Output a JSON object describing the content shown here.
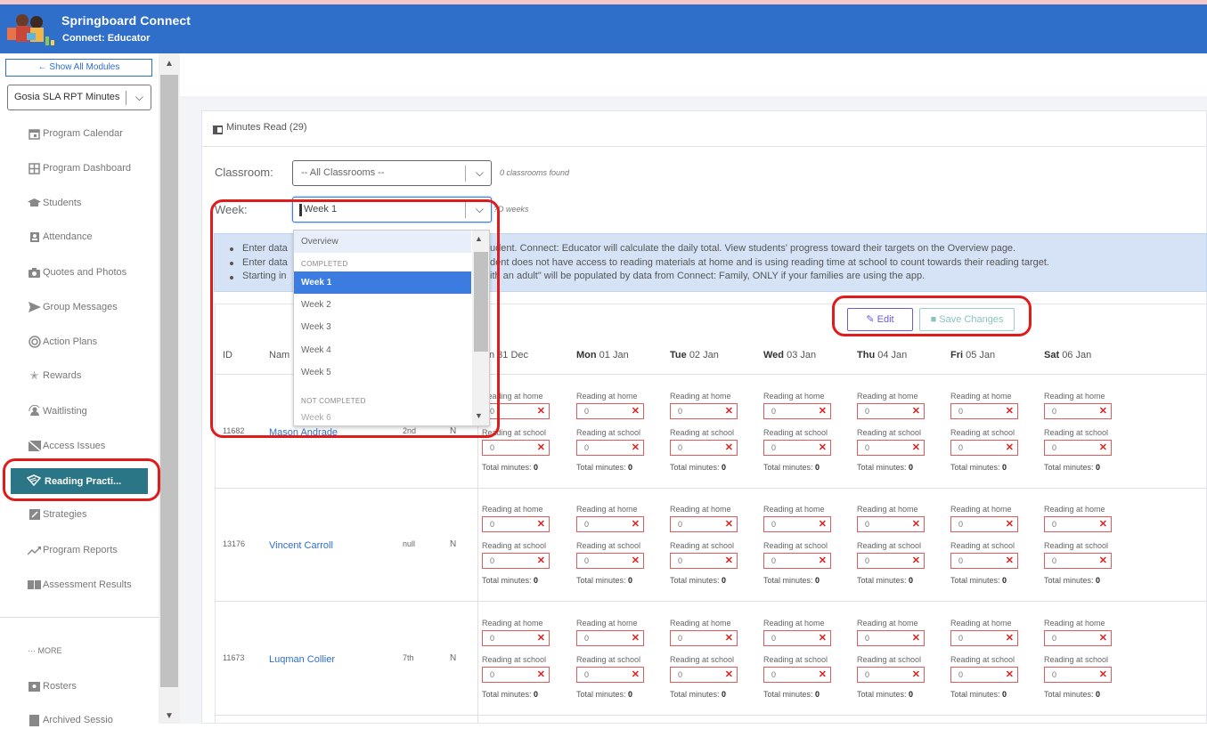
{
  "app": {
    "title": "Springboard Connect",
    "subtitle": "Connect: Educator"
  },
  "sidebar": {
    "show_all": "Show All Modules",
    "module": "Gosia SLA RPT Minutes",
    "items": [
      {
        "label": "Program Calendar",
        "icon": "calendar-icon"
      },
      {
        "label": "Program Dashboard",
        "icon": "dashboard-icon"
      },
      {
        "label": "Students",
        "icon": "graduation-cap-icon"
      },
      {
        "label": "Attendance",
        "icon": "id-badge-icon"
      },
      {
        "label": "Quotes and Photos",
        "icon": "camera-icon"
      },
      {
        "label": "Group Messages",
        "icon": "send-icon"
      },
      {
        "label": "Action Plans",
        "icon": "target-icon"
      },
      {
        "label": "Rewards",
        "icon": "trophy-icon"
      },
      {
        "label": "Waitlisting",
        "icon": "user-refresh-icon"
      },
      {
        "label": "Access Issues",
        "icon": "blocked-image-icon"
      },
      {
        "label": "Reading Practi...",
        "icon": "reading-icon"
      },
      {
        "label": "Strategies",
        "icon": "edit-square-icon"
      },
      {
        "label": "Program Reports",
        "icon": "trend-icon"
      },
      {
        "label": "Assessment Results",
        "icon": "book-icon"
      }
    ],
    "more": "··· MORE",
    "bottom_items": [
      {
        "label": "Rosters",
        "icon": "id-card-icon"
      },
      {
        "label": "Archived Sessio",
        "icon": "archive-icon"
      }
    ]
  },
  "panel": {
    "title": "Minutes Read (29)"
  },
  "filters": {
    "classroom_label": "Classroom:",
    "classroom_value": "-- All Classrooms --",
    "classroom_note": "0 classrooms found",
    "week_label": "Week:",
    "week_value": "Week 1",
    "week_note": "?D weeks"
  },
  "info": [
    {
      "start": "Enter data",
      "end": "udent. Connect: Educator will calculate the daily total. View students' progress toward their targets on the Overview page."
    },
    {
      "start": "Enter data",
      "end": "dent does not have access to reading materials at home and is using reading time at school to count towards their reading target."
    },
    {
      "start": "Starting in",
      "end": "ith an adult\" will be populated by data from Connect: Family, ONLY if your families are using the app."
    }
  ],
  "buttons": {
    "edit": "Edit",
    "save": "Save Changes"
  },
  "table": {
    "headers": {
      "id": "ID",
      "name": "Nam"
    },
    "days": [
      {
        "dow": "",
        "date": "n 31 Dec"
      },
      {
        "dow": "Mon",
        "date": "01 Jan"
      },
      {
        "dow": "Tue",
        "date": "02 Jan"
      },
      {
        "dow": "Wed",
        "date": "03 Jan"
      },
      {
        "dow": "Thu",
        "date": "04 Jan"
      },
      {
        "dow": "Fri",
        "date": "05 Jan"
      },
      {
        "dow": "Sat",
        "date": "06 Jan"
      }
    ],
    "home_label": "Reading at home",
    "school_label": "Reading at school",
    "total_label": "Total minutes:",
    "rows": [
      {
        "id": "11682",
        "name": "Mason Andrade",
        "grade": "2nd",
        "flag": "N",
        "home": "0",
        "school": "0",
        "total": "0"
      },
      {
        "id": "13176",
        "name": "Vincent Carroll",
        "grade": "null",
        "flag": "N",
        "home": "0",
        "school": "0",
        "total": "0"
      },
      {
        "id": "11673",
        "name": "Luqman Collier",
        "grade": "7th",
        "flag": "N",
        "home": "0",
        "school": "0",
        "total": "0"
      }
    ]
  },
  "week_dropdown": {
    "overview": "Overview",
    "completed_group": "COMPLETED",
    "completed": [
      "Week 1",
      "Week 2",
      "Week 3",
      "Week 4",
      "Week 5"
    ],
    "not_completed_group": "NOT COMPLETED",
    "not_completed": [
      "Week 6"
    ],
    "selected": "Week 1"
  },
  "colors": {
    "header": "#2f6fc9",
    "active_nav": "#2a7686",
    "highlight": "#e01b1b",
    "dropdown_selected": "#3c7be0"
  }
}
